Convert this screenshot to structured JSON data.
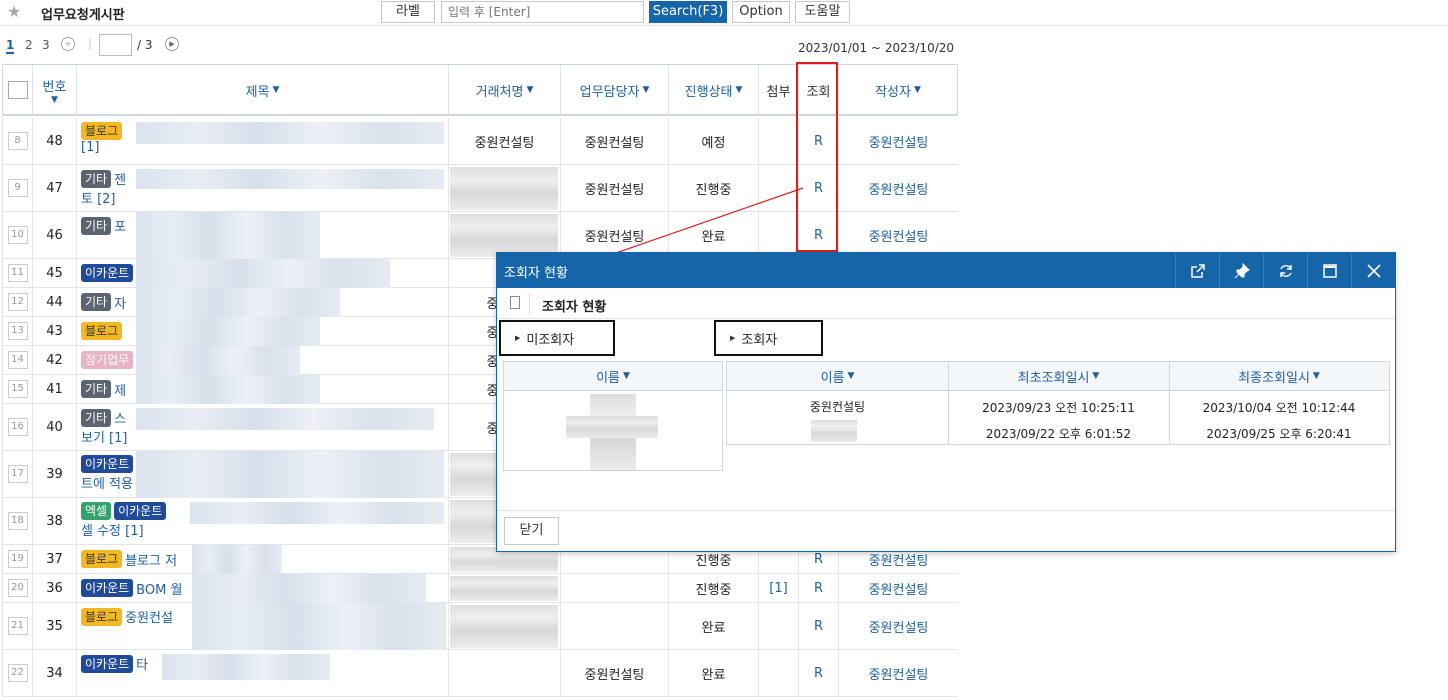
{
  "toolbar": {
    "title": "업무요청게시판",
    "label_button": "라벨",
    "search_placeholder": "입력 후 [Enter]",
    "search_button": "Search(F3)",
    "option_button": "Option",
    "help_button": "도움말"
  },
  "pager": {
    "pages": [
      "1",
      "2",
      "3"
    ],
    "current_page_input": "",
    "total": "/ 3",
    "date_range": "2023/01/01 ~ 2023/10/20"
  },
  "grid": {
    "headers": {
      "number": "번호",
      "title": "제목",
      "client": "거래처명",
      "assignee": "업무담당자",
      "status": "진행상태",
      "attach": "첨부",
      "view": "조회",
      "author": "작성자"
    },
    "rows": [
      {
        "rn": "8",
        "no": "48",
        "tags": [
          {
            "t": "블로그",
            "k": "blog"
          }
        ],
        "title": "",
        "cont": "[1]",
        "client": "중원컨설팅",
        "assignee": "중원컨설팅",
        "status": "예정",
        "attach": "",
        "view": "R",
        "author": "중원컨설팅"
      },
      {
        "rn": "9",
        "no": "47",
        "tags": [
          {
            "t": "기타",
            "k": "etc"
          }
        ],
        "title": "젠",
        "cont": "토 [2]",
        "client": "",
        "assignee": "중원컨설팅",
        "status": "진행중",
        "attach": "",
        "view": "R",
        "author": "중원컨설팅"
      },
      {
        "rn": "10",
        "no": "46",
        "tags": [
          {
            "t": "기타",
            "k": "etc"
          }
        ],
        "title": "포",
        "cont": "",
        "client": "",
        "assignee": "중원컨설팅",
        "status": "완료",
        "attach": "",
        "view": "R",
        "author": "중원컨설팅"
      },
      {
        "rn": "11",
        "no": "45",
        "tags": [
          {
            "t": "이카운트",
            "k": "ecount"
          }
        ],
        "title": "",
        "cont": "",
        "client": "",
        "assignee": "",
        "status": "",
        "attach": "",
        "view": "",
        "author": ""
      },
      {
        "rn": "12",
        "no": "44",
        "tags": [
          {
            "t": "기타",
            "k": "etc"
          }
        ],
        "title": "자",
        "cont": "",
        "client": "중원컨",
        "assignee": "",
        "status": "",
        "attach": "",
        "view": "",
        "author": ""
      },
      {
        "rn": "13",
        "no": "43",
        "tags": [
          {
            "t": "블로그",
            "k": "blog"
          }
        ],
        "title": "",
        "cont": "",
        "client": "중원컨",
        "assignee": "",
        "status": "",
        "attach": "",
        "view": "",
        "author": ""
      },
      {
        "rn": "14",
        "no": "42",
        "tags": [
          {
            "t": "정기업무",
            "k": "regular"
          }
        ],
        "title": "",
        "cont": "",
        "client": "중원컨",
        "assignee": "",
        "status": "",
        "attach": "",
        "view": "",
        "author": ""
      },
      {
        "rn": "15",
        "no": "41",
        "tags": [
          {
            "t": "기타",
            "k": "etc"
          }
        ],
        "title": "제",
        "cont": "",
        "client": "중원컨",
        "assignee": "",
        "status": "",
        "attach": "",
        "view": "",
        "author": ""
      },
      {
        "rn": "16",
        "no": "40",
        "tags": [
          {
            "t": "기타",
            "k": "etc"
          }
        ],
        "title": "스",
        "cont": "보기 [1]",
        "client": "중원컨",
        "assignee": "",
        "status": "",
        "attach": "",
        "view": "",
        "author": ""
      },
      {
        "rn": "17",
        "no": "39",
        "tags": [
          {
            "t": "이카운트",
            "k": "ecount"
          }
        ],
        "title": "",
        "cont": "트에 적용",
        "client": "",
        "assignee": "",
        "status": "",
        "attach": "",
        "view": "",
        "author": ""
      },
      {
        "rn": "18",
        "no": "38",
        "tags": [
          {
            "t": "엑셀",
            "k": "excel"
          },
          {
            "t": "이카운트",
            "k": "ecount"
          }
        ],
        "title": "",
        "cont": "셀 수정 [1]",
        "client": "",
        "assignee": "",
        "status": "",
        "attach": "",
        "view": "",
        "author": ""
      },
      {
        "rn": "19",
        "no": "37",
        "tags": [
          {
            "t": "블로그",
            "k": "blog"
          }
        ],
        "title": "블로그 저",
        "cont": "",
        "client": "",
        "assignee": "",
        "status": "진행중",
        "attach": "",
        "view": "R",
        "author": "중원컨설팅"
      },
      {
        "rn": "20",
        "no": "36",
        "tags": [
          {
            "t": "이카운트",
            "k": "ecount"
          }
        ],
        "title": "BOM 월",
        "cont": "",
        "client": "",
        "assignee": "",
        "status": "진행중",
        "attach": "[1]",
        "view": "R",
        "author": "중원컨설팅"
      },
      {
        "rn": "21",
        "no": "35",
        "tags": [
          {
            "t": "블로그",
            "k": "blog"
          }
        ],
        "title": "중원컨설",
        "cont": "",
        "client": "",
        "assignee": "",
        "status": "완료",
        "attach": "",
        "view": "R",
        "author": "중원컨설팅"
      },
      {
        "rn": "22",
        "no": "34",
        "tags": [
          {
            "t": "이카운트",
            "k": "ecount"
          }
        ],
        "title": "타",
        "cont": "",
        "client": "",
        "assignee": "중원컨설팅",
        "status": "완료",
        "attach": "",
        "view": "R",
        "author": "중원컨설팅"
      }
    ]
  },
  "popup": {
    "title": "조회자 현황",
    "icons": [
      "external-link-icon",
      "pin-icon",
      "refresh-icon",
      "maximize-icon",
      "close-icon"
    ],
    "sub_title": "조회자 현황",
    "unread_label": "미조회자",
    "read_label": "조회자",
    "unread_table": {
      "header_name": "이름"
    },
    "read_table": {
      "header_name": "이름",
      "header_first": "최초조회일시",
      "header_last": "최종조회일시",
      "rows": [
        {
          "name": "중원컨설팅",
          "first": "2023/09/23 오전 10:25:11",
          "last": "2023/10/04 오전 10:12:44"
        },
        {
          "name": "",
          "first": "2023/09/22 오후 6:01:52",
          "last": "2023/09/25 오후 6:20:41"
        }
      ]
    },
    "close_button": "닫기"
  },
  "colors": {
    "accent": "#1565a8",
    "highlight": "#e01d1d"
  }
}
